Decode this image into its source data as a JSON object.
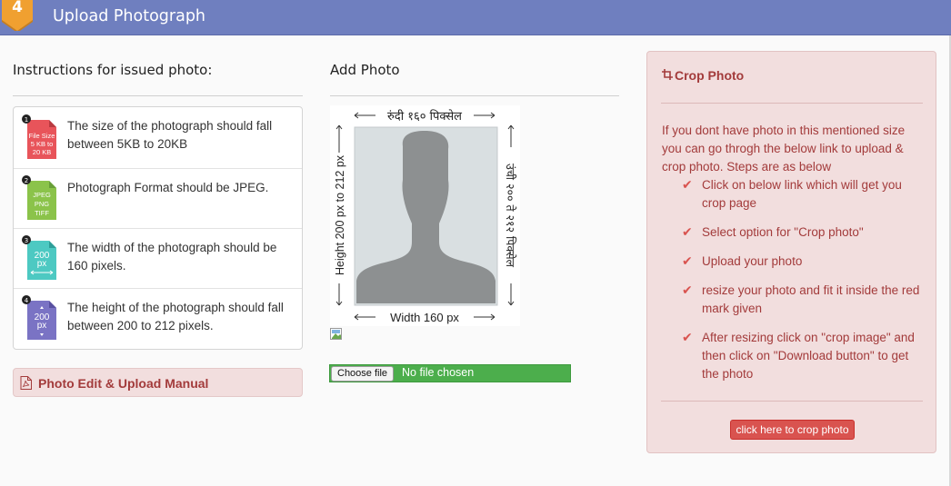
{
  "header": {
    "step_number": "4",
    "title": "Upload Photograph"
  },
  "instructions": {
    "title": "Instructions for issued photo:",
    "items": [
      {
        "number": "1",
        "icon_text": [
          "File Size",
          "5 KB to",
          "20 KB"
        ],
        "text": "The size of the photograph should fall between 5KB to 20KB",
        "color": "#e8545a"
      },
      {
        "number": "2",
        "icon_text": [
          "JPEG",
          "PNG",
          "TIFF"
        ],
        "text": "Photograph Format should be JPEG.",
        "color": "#8bc34a"
      },
      {
        "number": "3",
        "icon_text": [
          "200",
          "px"
        ],
        "text": "The width of the photograph should be 160 pixels.",
        "color": "#4dc9c2"
      },
      {
        "number": "4",
        "icon_text": [
          "200",
          "px"
        ],
        "text": "The height of the photograph should fall between 200 to 212 pixels.",
        "color": "#7a73c4"
      }
    ]
  },
  "manual_button": {
    "label": "Photo Edit & Upload Manual"
  },
  "add_photo": {
    "title": "Add Photo",
    "guide": {
      "top_label": "रुंदी १६० पिक्सेल",
      "bottom_label": "Width 160 px",
      "left_label": "Height 200 px to 212 px",
      "right_label": "उंची २०० ते २१२ पिक्सेल"
    },
    "file_input": {
      "button_label": "Choose file",
      "status": "No file chosen"
    }
  },
  "crop_panel": {
    "title": "Crop Photo",
    "intro": "If you dont have photo in this mentioned size you can go throgh the below link to upload & crop photo. Steps are as below",
    "steps": [
      "Click on below link which will get you crop page",
      "Select option for \"Crop photo\"",
      "Upload your photo",
      "resize your photo and fit it inside the red mark given",
      "After resizing click on \"crop image\" and then click on \"Download button\" to get the photo"
    ],
    "link_label": "click here to crop photo"
  },
  "colors": {
    "header_bg": "#6f7fbf",
    "badge": "#f0a030",
    "panel_bg": "#f2dede",
    "panel_text": "#a33b3b",
    "danger": "#d9534f",
    "file_bar": "#4cae4c"
  }
}
